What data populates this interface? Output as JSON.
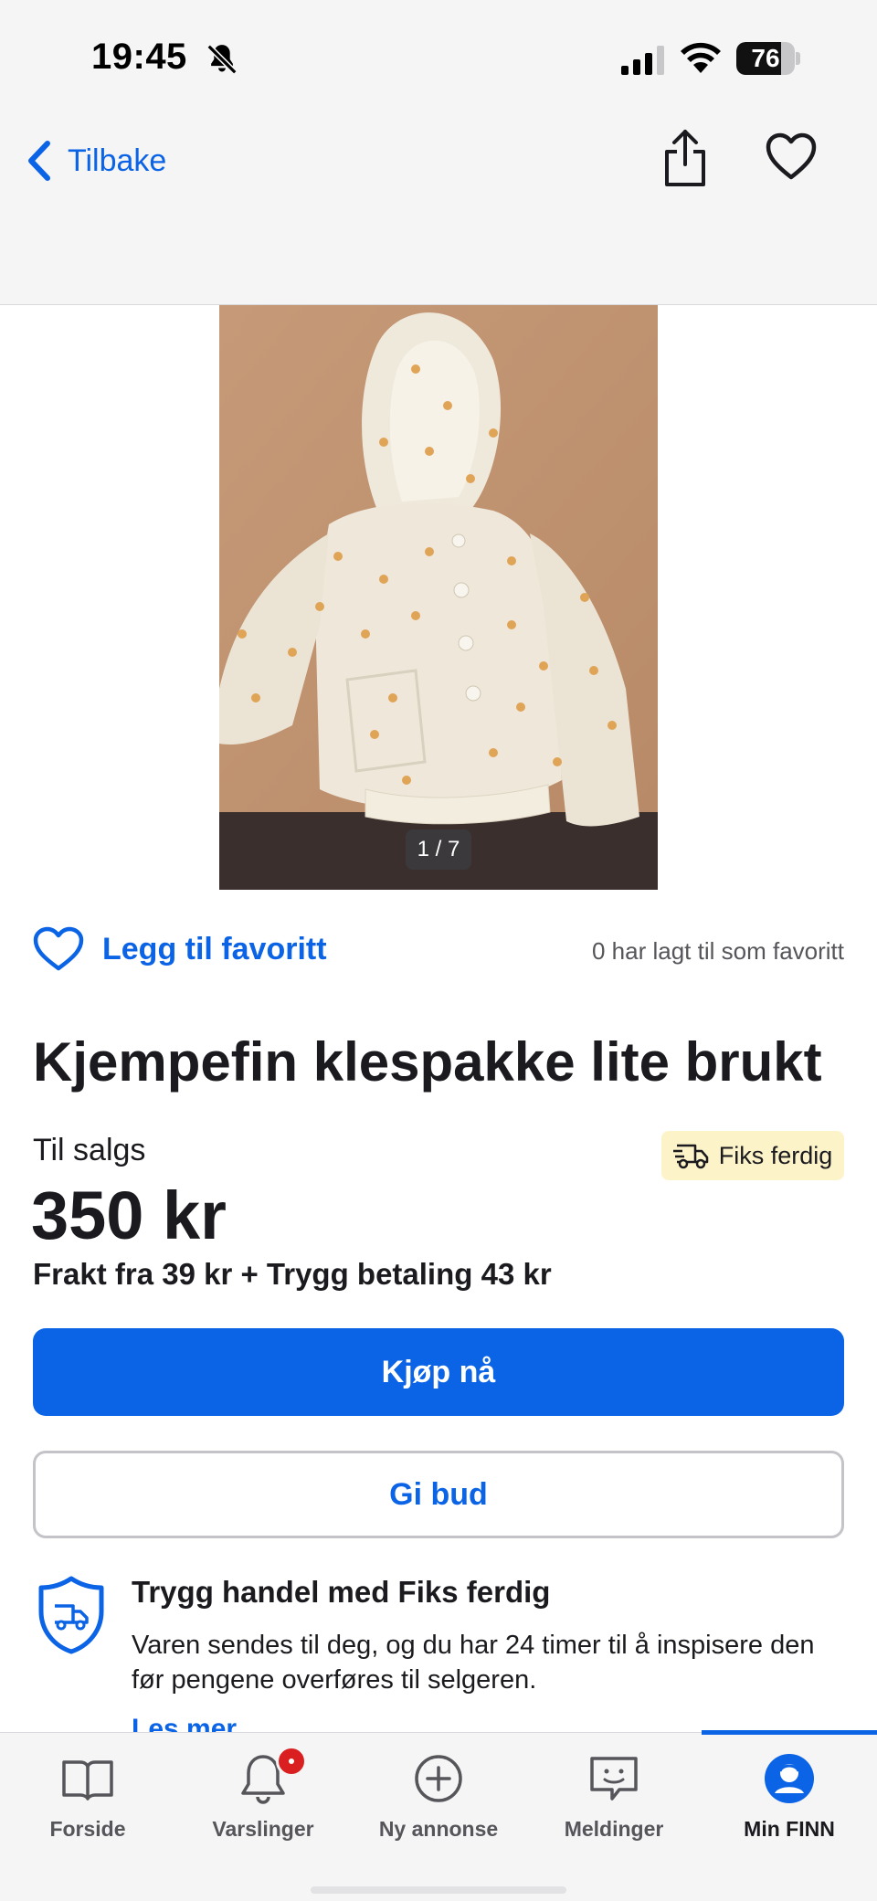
{
  "status_bar": {
    "time": "19:45",
    "battery_level": "76",
    "battery_fraction": 0.76
  },
  "nav": {
    "back_label": "Tilbake",
    "share_icon": "share-icon",
    "favorite_icon": "heart-outline-icon"
  },
  "gallery": {
    "counter": "1 / 7",
    "current": 1,
    "total": 7
  },
  "favorite": {
    "label": "Legg til favoritt",
    "count_text": "0 har lagt til som favoritt"
  },
  "listing": {
    "title": "Kjempefin klespakke lite brukt",
    "sale_label": "Til salgs",
    "price": "350 kr",
    "shipping": "Frakt fra 39 kr + Trygg betaling 43 kr",
    "badge": "Fiks ferdig"
  },
  "actions": {
    "buy_label": "Kjøp nå",
    "bid_label": "Gi bud"
  },
  "safe_trade": {
    "title": "Trygg handel med Fiks ferdig",
    "body": "Varen sendes til deg, og du har 24 timer til å inspisere den før pengene overføres til selgeren.",
    "link": "Les mer"
  },
  "tabbar": {
    "items": [
      {
        "label": "Forside",
        "icon": "book-icon"
      },
      {
        "label": "Varslinger",
        "icon": "bell-icon"
      },
      {
        "label": "Ny annonse",
        "icon": "plus-circle-icon"
      },
      {
        "label": "Meldinger",
        "icon": "chat-icon"
      },
      {
        "label": "Min FINN",
        "icon": "profile-icon",
        "active": true
      }
    ]
  },
  "colors": {
    "brand_blue": "#0b63e5",
    "badge_yellow": "#fdf3c9",
    "notification_red": "#d91f1f"
  }
}
